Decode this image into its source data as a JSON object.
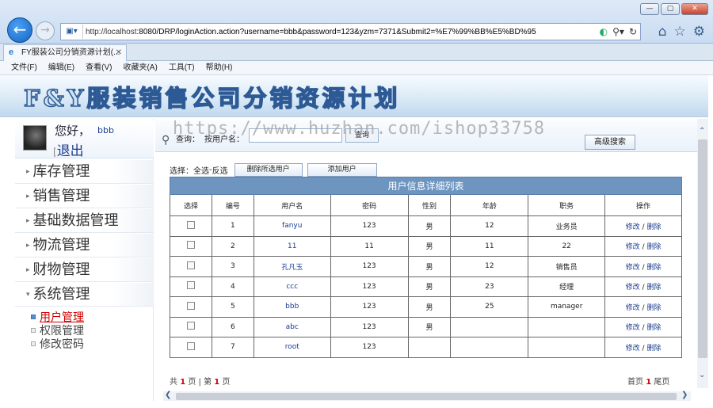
{
  "browser": {
    "url_host": "http://localhost",
    "url_rest": ":8080/DRP/loginAction.action?username=bbb&password=123&yzm=7371&Submit2=%E7%99%BB%E5%BD%95",
    "tab_title": "FY服装公司分销资源计划(...",
    "window_buttons": [
      "—",
      "▢",
      "✕"
    ],
    "menu": [
      "文件(F)",
      "编辑(E)",
      "查看(V)",
      "收藏夹(A)",
      "工具(T)",
      "帮助(H)"
    ]
  },
  "banner": {
    "title": "F&Y服装销售公司分销资源计划"
  },
  "user": {
    "greeting": "您好，",
    "name": "bbb",
    "logout": "退出",
    "bracket": "["
  },
  "sidebar": {
    "items": [
      "库存管理",
      "销售管理",
      "基础数据管理",
      "物流管理",
      "财物管理",
      "系统管理"
    ],
    "sub_items": [
      "用户管理",
      "权限管理",
      "修改密码"
    ]
  },
  "search": {
    "label": "查询：",
    "field_label": "按用户名：",
    "button": "查询",
    "advanced": "高级搜索"
  },
  "watermark": "https://www.huzhan.com/ishop33758",
  "actions": {
    "select_label": "选择：",
    "select_all": "全选",
    "separator": "-",
    "invert": "反选",
    "delete_selected": "删除所选用户",
    "add_user": "添加用户"
  },
  "table": {
    "caption": "用户信息详细列表",
    "headers": [
      "选择",
      "编号",
      "用户名",
      "密码",
      "性别",
      "年龄",
      "职务",
      "操作"
    ],
    "rows": [
      {
        "id": "1",
        "name": "fanyu",
        "password": "123",
        "gender": "男",
        "age": "12",
        "role": "业务员"
      },
      {
        "id": "2",
        "name": "11",
        "password": "11",
        "gender": "男",
        "age": "11",
        "role": "22"
      },
      {
        "id": "3",
        "name": "孔凡玉",
        "password": "123",
        "gender": "男",
        "age": "12",
        "role": "销售员"
      },
      {
        "id": "4",
        "name": "ccc",
        "password": "123",
        "gender": "男",
        "age": "23",
        "role": "经理"
      },
      {
        "id": "5",
        "name": "bbb",
        "password": "123",
        "gender": "男",
        "age": "25",
        "role": "manager"
      },
      {
        "id": "6",
        "name": "abc",
        "password": "123",
        "gender": "男",
        "age": "",
        "role": ""
      },
      {
        "id": "7",
        "name": "root",
        "password": "123",
        "gender": "",
        "age": "",
        "role": ""
      }
    ],
    "op_edit": "修改",
    "op_sep": "/",
    "op_delete": "删除"
  },
  "pager": {
    "total_prefix": "共",
    "total": "1",
    "total_suffix": "页",
    "sep": "|",
    "page_prefix": "第",
    "page": "1",
    "page_suffix": "页",
    "first": "首页",
    "last_num": "1",
    "last": "尾页"
  }
}
